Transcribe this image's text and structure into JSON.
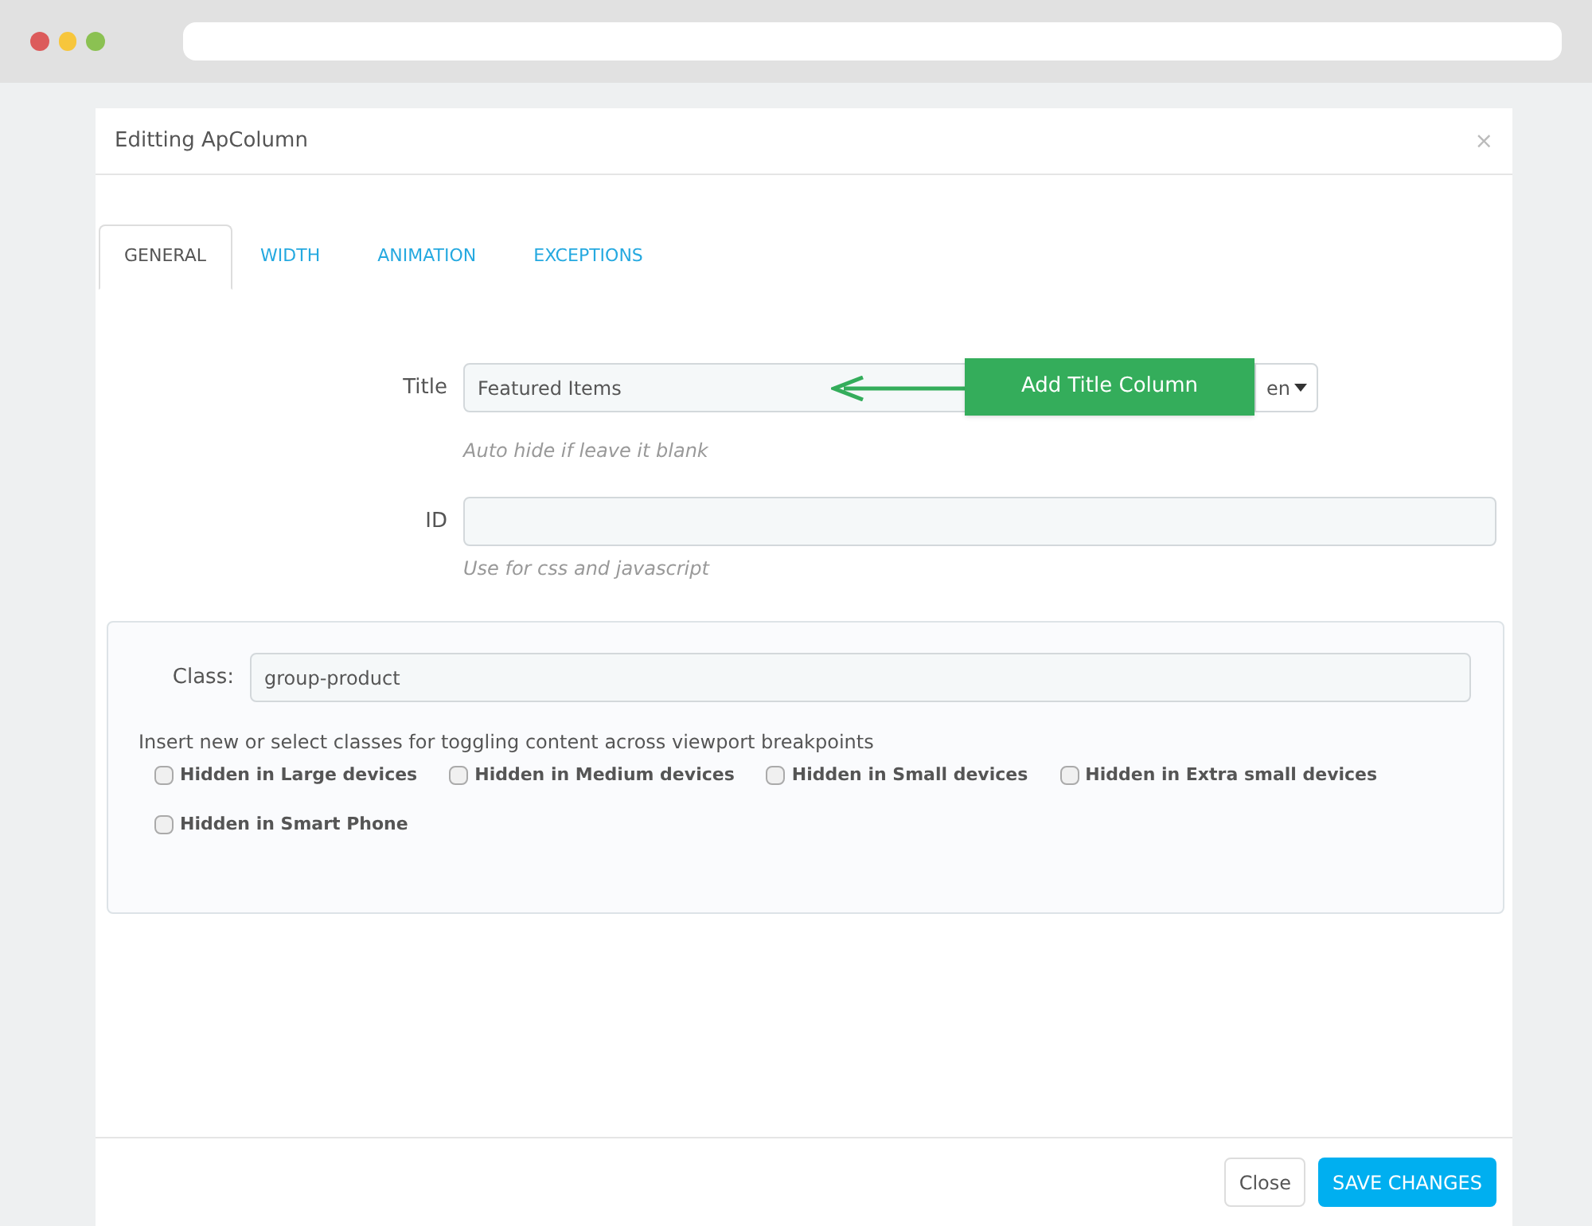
{
  "modal": {
    "title": "Editting ApColumn",
    "close": "×"
  },
  "tabs": [
    {
      "label": "GENERAL",
      "selected": true
    },
    {
      "label": "WIDTH",
      "selected": false
    },
    {
      "label": "ANIMATION",
      "selected": false
    },
    {
      "label": "EXCEPTIONS",
      "selected": false
    }
  ],
  "title_field": {
    "label": "Title",
    "value": "Featured Items",
    "language": "en",
    "hint": "Auto hide if leave it blank"
  },
  "callout": {
    "text": "Add Title Column"
  },
  "id_field": {
    "label": "ID",
    "hint": "Use for css and javascript"
  },
  "class_panel": {
    "label": "Class:",
    "value": "group-product",
    "help": "Insert new or select classes for toggling content across viewport breakpoints",
    "options": [
      {
        "label": "Hidden in Large devices",
        "checked": false
      },
      {
        "label": "Hidden in Medium devices",
        "checked": false
      },
      {
        "label": "Hidden in Small devices",
        "checked": false
      },
      {
        "label": "Hidden in Extra small devices",
        "checked": false
      },
      {
        "label": "Hidden in Smart Phone",
        "checked": false
      }
    ]
  },
  "buttons": {
    "close": "Close",
    "save": "SAVE CHANGES"
  }
}
